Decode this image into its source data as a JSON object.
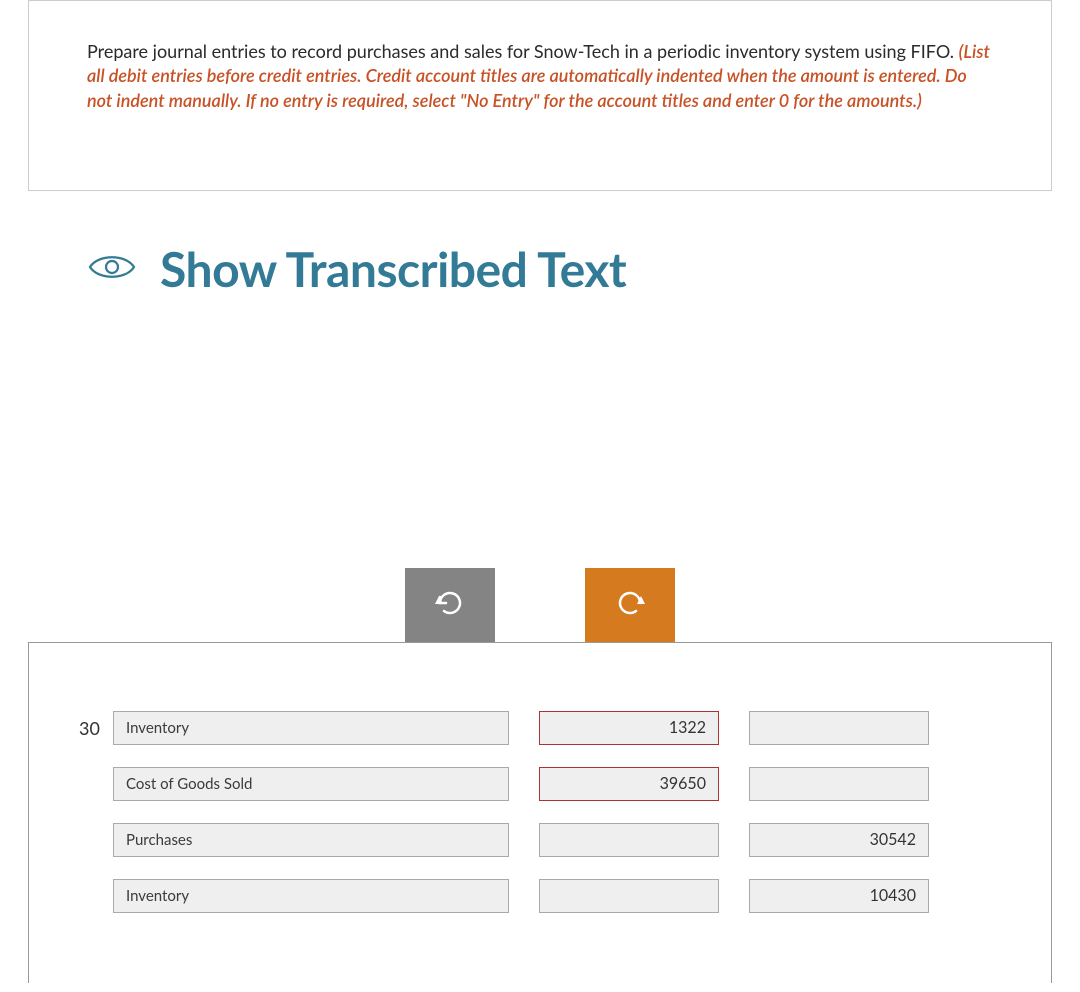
{
  "instruction": {
    "intro": "Prepare journal entries to record purchases and sales for Snow-Tech in a periodic inventory system using FIFO. ",
    "highlight": "(List all debit entries before credit entries. Credit account titles are automatically indented when the amount is entered. Do not indent manually. If no entry is required, select \"No Entry\" for the account titles and enter 0 for the amounts.)"
  },
  "transcribedHeading": "Show Transcribed Text",
  "controls": {
    "undo": "undo",
    "redo": "redo"
  },
  "entries": {
    "day": "30",
    "rows": [
      {
        "account": "Inventory",
        "debit": "1322",
        "credit": "",
        "debitHighlight": true
      },
      {
        "account": "Cost of Goods Sold",
        "debit": "39650",
        "credit": "",
        "debitHighlight": true
      },
      {
        "account": "Purchases",
        "debit": "",
        "credit": "30542",
        "debitHighlight": false
      },
      {
        "account": "Inventory",
        "debit": "",
        "credit": "10430",
        "debitHighlight": false
      }
    ]
  }
}
